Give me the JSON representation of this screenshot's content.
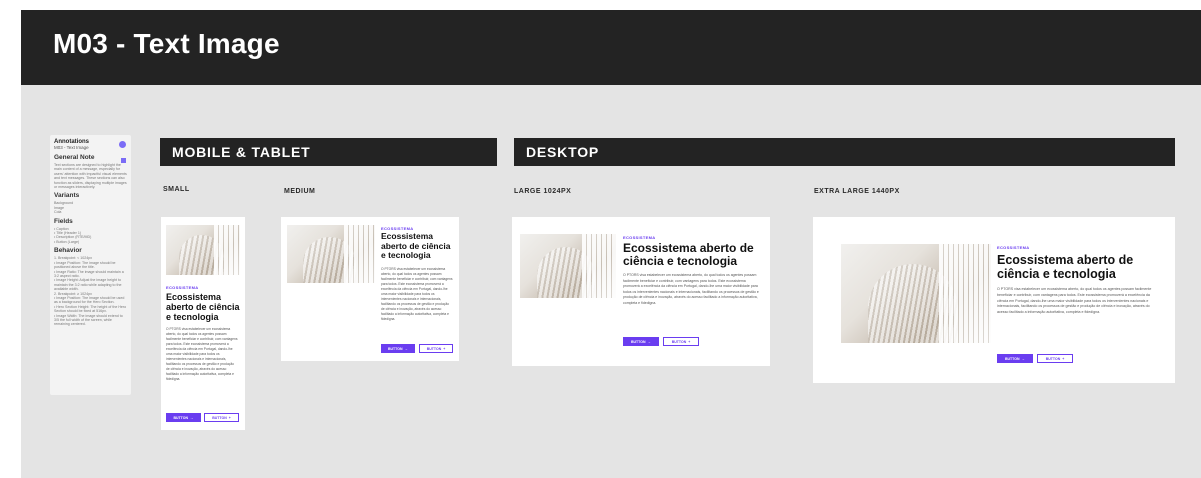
{
  "title": "M03 - Text Image",
  "annotations": {
    "title": "Annotations",
    "subtitle": "M03 - Text Image",
    "general_heading": "General Note",
    "general_text": "Text sections are designed to highlight the main content of a message, especially for users' attention with impactful visual elements and text messages. These sections can also function as sliders, displaying multiple images or messages interactively.",
    "variants_heading": "Variants",
    "variants_items": [
      "Background",
      "Image",
      "Cola"
    ],
    "fields_heading": "Fields",
    "fields_items": [
      "• Caption",
      "• Title (Header 1)",
      "• Description (RTE/MD)",
      "• Button (Large)"
    ],
    "behavior_heading": "Behavior",
    "behavior_items": [
      "1. Breakpoint: < 1024px",
      "• Image Position: The image should be positioned above the title.",
      "• Image Ratio: The image should maintain a 3:2 aspect ratio.",
      "• Image Height: Adjust the image height to maintain the 3:2 ratio while adapting to the available width.",
      "2. Breakpoint: ≥ 1024px",
      "• Image Position: The image should be used as a background for the Hero Section.",
      "• Hero Section Height: The height of the Hero Section should be fixed at 516px.",
      "• Image Width: The image should extend to 3/5 the full width of the screen, while remaining centered."
    ]
  },
  "sections": {
    "mobile_tablet": "MOBILE & TABLET",
    "desktop": "DESKTOP"
  },
  "breakpoints": {
    "small": "SMALL",
    "medium": "MEDIUM",
    "large": "LARGE 1024PX",
    "xlarge": "EXTRA LARGE 1440PX"
  },
  "card": {
    "eyebrow": "ECOSSISTEMA",
    "title": "Ecossistema aberto de ciência e tecnologia",
    "body": "O PTORS visa estabelecer um ecossistema aberto, do qual todos os agentes possam facilmente beneficiar e contribuir, com vantagens para todos. Este ecossistema promoverá a excelência da ciência em Portugal, dando-lhe uma maior visibilidade para todos os intervenientes nacionais e internacionais, facilitando os processos de gestão e produção de ciência e inovação, através do acesso facilitado a informação autoritativa, completa e fidedigna.",
    "button_primary": "BUTTON",
    "button_secondary": "BUTTON",
    "arrow": "→",
    "plus": "+"
  },
  "colors": {
    "header_bg": "#232323",
    "canvas_bg": "#e4e4e4",
    "accent": "#6a3df0"
  }
}
